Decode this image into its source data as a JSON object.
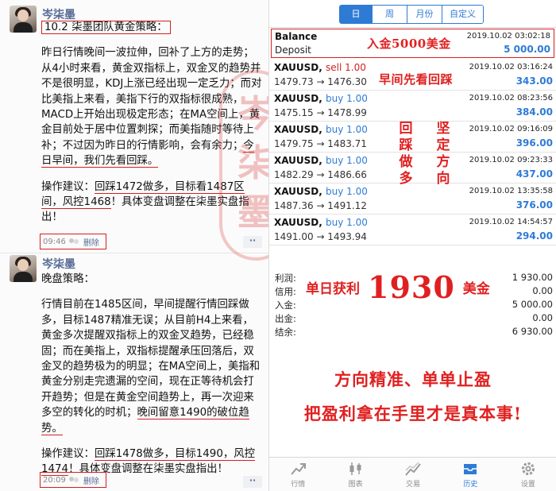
{
  "left": {
    "posts": [
      {
        "author": "岑柒墨",
        "title": "10.2 柒墨团队黄金策略：",
        "p1": "昨日行情晚间一波拉伸，回补了上方的走势；从4小时来看，黄金双指标上，双金叉的趋势并不是很明显，KDJ上涨已经出现一定乏力；而对比美指上来看，美指下行的双指标很成熟，MACD上开始出现极定形态；在MA空间上，黄金目前处于居中位置刺探；而美指随时等待上补；不过因为昨日的行情影响，会有余力；",
        "p1_underlined": "今日早间，我们先看回踩。",
        "advice_label": "操作建议：",
        "advice_underlined": "回踩1472做多，目标看1487区间，风控1468",
        "advice_tail": "！具体变盘调整在柒墨实盘指出！",
        "time": "09:46",
        "delete": "删除"
      },
      {
        "author": "岑柒墨",
        "title": "晚盘策略：",
        "p1": "行情目前在1485区间，早间提醒行情回踩做多，目标1487精准无误；从目前H4上来看，黄金多次提醒双指标上的双金叉趋势，已经稳固；而在美指上，双指标提醒承压回落后，双金叉的趋势极为的明显；在MA空间上，美指和黄金分别走完遗漏的空间，现在正等待机会打开趋势；但是在黄金空间趋势上，再一次迎来多空的转化的时机；",
        "p1_underlined": "晚间留意1490的破位趋势。",
        "advice_label": "操作建议：",
        "advice_underlined": "回踩1478做多，目标1490，风控1474",
        "advice_tail": "！具体变盘调整在柒墨实盘指出！",
        "time": "20:09",
        "delete": "删除"
      }
    ],
    "seal": "岑柒墨"
  },
  "right": {
    "tabs": [
      "日",
      "周",
      "月份",
      "自定义"
    ],
    "active_tab": 0,
    "balance": {
      "label": "Balance",
      "sublabel": "Deposit",
      "time": "2019.10.02 03:02:18",
      "value": "5 000.00",
      "note": "入金5000美金"
    },
    "trades": [
      {
        "symbol": "XAUUSD,",
        "side": "sell 1.00",
        "prices": "1479.73 → 1476.30",
        "time": "2019.10.02 03:16:24",
        "profit": "343.00"
      },
      {
        "symbol": "XAUUSD,",
        "side": "buy 1.00",
        "prices": "1475.15 → 1478.99",
        "time": "2019.10.02 08:23:56",
        "profit": "384.00"
      },
      {
        "symbol": "XAUUSD,",
        "side": "buy 1.00",
        "prices": "1479.75 → 1483.71",
        "time": "2019.10.02 09:16:09",
        "profit": "396.00"
      },
      {
        "symbol": "XAUUSD,",
        "side": "buy 1.00",
        "prices": "1482.29 → 1486.66",
        "time": "2019.10.02 09:23:33",
        "profit": "437.00"
      },
      {
        "symbol": "XAUUSD,",
        "side": "buy 1.00",
        "prices": "1487.36 → 1491.12",
        "time": "2019.10.02 13:35:58",
        "profit": "376.00"
      },
      {
        "symbol": "XAUUSD,",
        "side": "buy 1.00",
        "prices": "1491.00 → 1493.94",
        "time": "2019.10.02 14:54:57",
        "profit": "294.00"
      }
    ],
    "notes": {
      "early": "早间先看回踩",
      "col1": "回踩做多",
      "col2": "坚定方向"
    },
    "summary": [
      {
        "label": "利润:",
        "value": "1 930.00"
      },
      {
        "label": "信用:",
        "value": "0.00"
      },
      {
        "label": "入金:",
        "value": "5 000.00"
      },
      {
        "label": "出金:",
        "value": "0.00"
      },
      {
        "label": "结余:",
        "value": "6 930.00"
      }
    ],
    "profit_note": {
      "pre": "单日获利",
      "amount": "1930",
      "post": "美金"
    },
    "slogans": [
      "方向精准、单单止盈",
      "把盈利拿在手里才是真本事!"
    ],
    "nav": [
      {
        "label": "行情",
        "icon": "trend-arrow-icon"
      },
      {
        "label": "图表",
        "icon": "candlestick-icon"
      },
      {
        "label": "交易",
        "icon": "trade-chart-icon"
      },
      {
        "label": "历史",
        "icon": "history-inbox-icon"
      },
      {
        "label": "设置",
        "icon": "gear-icon"
      }
    ],
    "active_nav": 3,
    "accent_color": "#2e7bd6",
    "annotation_color": "#e02020"
  }
}
